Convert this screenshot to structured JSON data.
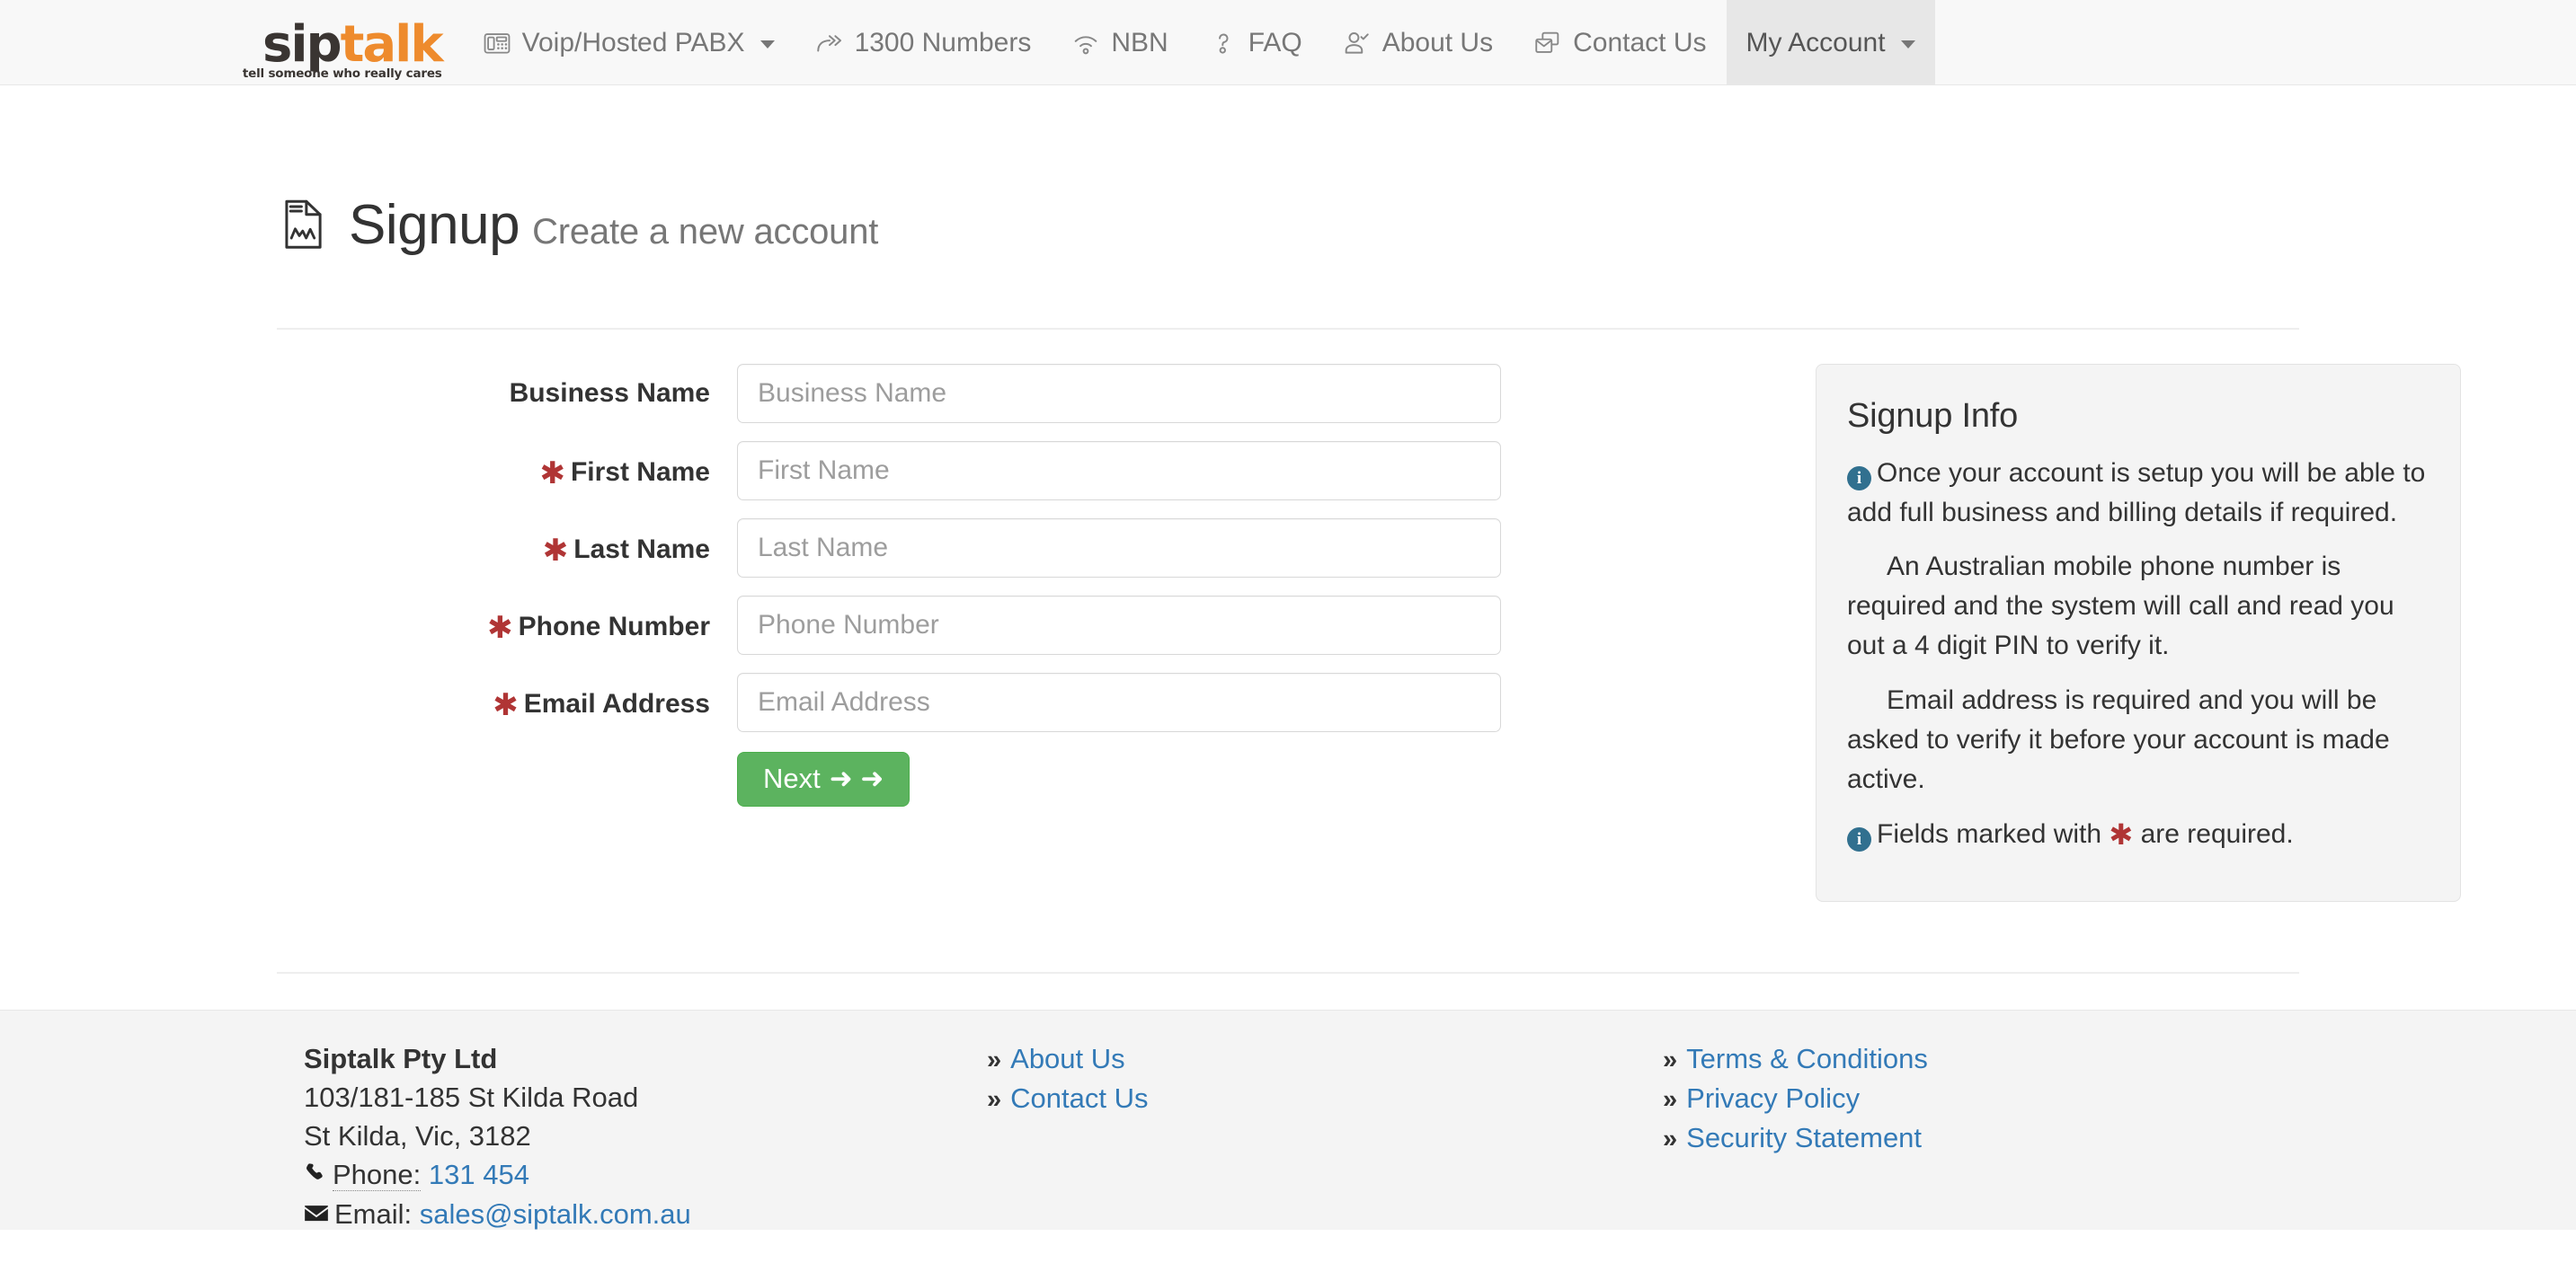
{
  "navbar": {
    "logo": {
      "part1": "sip",
      "part2": "talk",
      "tagline": "tell someone who really cares"
    },
    "items": [
      {
        "label": "Voip/Hosted PABX",
        "icon": "desk-phone-icon",
        "caret": true,
        "active": false
      },
      {
        "label": "1300 Numbers",
        "icon": "forward-arrows-icon",
        "caret": false,
        "active": false
      },
      {
        "label": "NBN",
        "icon": "wifi-icon",
        "caret": false,
        "active": false
      },
      {
        "label": "FAQ",
        "icon": "question-mark-icon",
        "caret": false,
        "active": false
      },
      {
        "label": "About Us",
        "icon": "user-check-icon",
        "caret": false,
        "active": false
      },
      {
        "label": "Contact Us",
        "icon": "envelope-stack-icon",
        "caret": false,
        "active": false
      },
      {
        "label": "My Account",
        "icon": "",
        "caret": true,
        "active": true
      }
    ]
  },
  "page": {
    "title": "Signup",
    "subtitle": "Create a new account",
    "icon": "file-chart-icon"
  },
  "form": {
    "fields": [
      {
        "label": "Business Name",
        "required": false,
        "placeholder": "Business Name",
        "value": "",
        "name": "business-name"
      },
      {
        "label": "First Name",
        "required": true,
        "placeholder": "First Name",
        "value": "",
        "name": "first-name"
      },
      {
        "label": "Last Name",
        "required": true,
        "placeholder": "Last Name",
        "value": "",
        "name": "last-name"
      },
      {
        "label": "Phone Number",
        "required": true,
        "placeholder": "Phone Number",
        "value": "",
        "name": "phone-number"
      },
      {
        "label": "Email Address",
        "required": true,
        "placeholder": "Email Address",
        "value": "",
        "name": "email-address"
      }
    ],
    "required_marker": "✱",
    "next_button": {
      "label": "Next",
      "arrows": "➜ ➜"
    }
  },
  "info_panel": {
    "title": "Signup Info",
    "paragraphs": [
      "Once your account is setup you will be able to add full business and billing details if required.",
      "An Australian mobile phone number is required and the system will call and read you out a 4 digit PIN to verify it.",
      "Email address is required and you will be asked to verify it before your account is made active."
    ],
    "required_note_before": "Fields marked with",
    "required_note_marker": "✱",
    "required_note_after": "are required."
  },
  "footer": {
    "company": {
      "name": "Siptalk Pty Ltd",
      "address_line1": "103/181-185 St Kilda Road",
      "address_line2": "St Kilda, Vic, 3182",
      "phone_label": "Phone:",
      "phone_value": "131 454",
      "email_label": "Email:",
      "email_value": "sales@siptalk.com.au"
    },
    "links_col2": [
      {
        "label": "About Us"
      },
      {
        "label": "Contact Us"
      }
    ],
    "links_col3": [
      {
        "label": "Terms & Conditions"
      },
      {
        "label": "Privacy Policy"
      },
      {
        "label": "Security Statement"
      }
    ],
    "chevron": "»"
  },
  "colors": {
    "brand_orange": "#ee8b2d",
    "brand_dark": "#3a3532",
    "link_blue": "#337ab7",
    "required_red": "#b03535",
    "success_green": "#5cb35f",
    "info_blue": "#31708f",
    "panel_bg": "#f4f4f4",
    "navbar_bg": "#f8f8f8"
  }
}
